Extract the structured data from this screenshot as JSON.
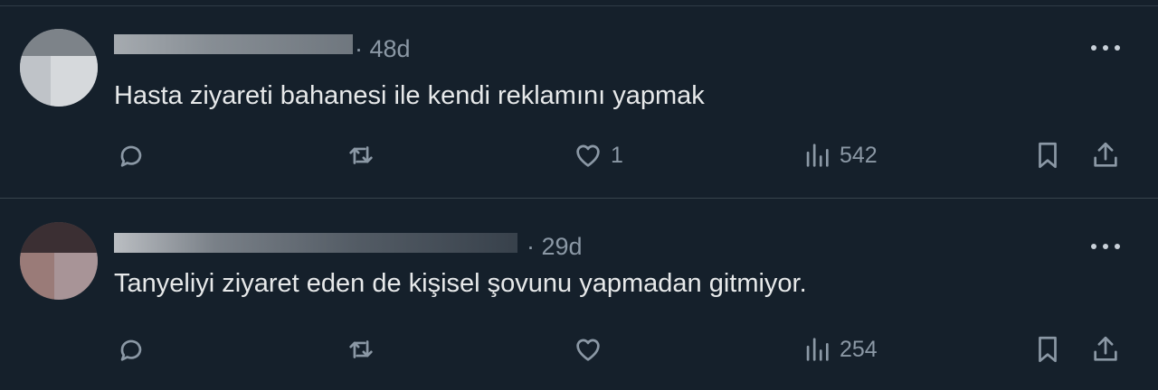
{
  "tweets": [
    {
      "time": "· 48d",
      "text": "Hasta ziyareti bahanesi ile kendi reklamını yapmak",
      "likes": "1",
      "views": "542",
      "retweets": "",
      "replies": ""
    },
    {
      "time": "· 29d",
      "text": "Tanyeliyi ziyaret eden de kişisel şovunu yapmadan gitmiyor.",
      "likes": "",
      "views": "254",
      "retweets": "",
      "replies": ""
    }
  ],
  "icons": {
    "reply": "reply-icon",
    "retweet": "retweet-icon",
    "like": "heart-icon",
    "views": "views-icon",
    "bookmark": "bookmark-icon",
    "share": "share-icon",
    "more": "more-icon"
  },
  "colors": {
    "background": "#15202b",
    "text": "#e7e9ea",
    "muted": "#8b98a5",
    "divider": "#38444d"
  }
}
